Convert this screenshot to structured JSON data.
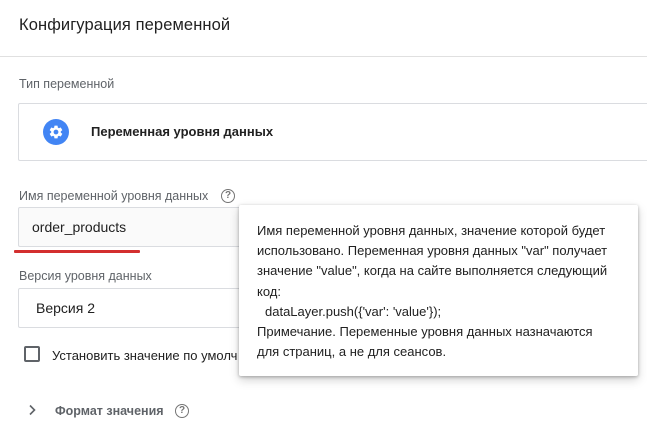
{
  "header": {
    "title": "Конфигурация переменной"
  },
  "variable_type": {
    "label": "Тип переменной",
    "name": "Переменная уровня данных",
    "icon": "gear-icon",
    "icon_color": "#4285f4"
  },
  "dlv_name": {
    "label": "Имя переменной уровня данных",
    "help_icon": "help-icon",
    "value": "order_products"
  },
  "dlv_version": {
    "label": "Версия уровня данных",
    "value": "Версия 2"
  },
  "default_value": {
    "label": "Установить значение по умолч",
    "checked": false
  },
  "format": {
    "label": "Формат значения",
    "icon": "chevron-right-icon"
  },
  "tooltip": {
    "lines": [
      "Имя переменной уровня данных, значение которой будет",
      "использовано. Переменная уровня данных \"var\" получает",
      "значение \"value\", когда на сайте выполняется следующий",
      "код:",
      "dataLayer.push({'var': 'value'});",
      "Примечание. Переменные уровня данных назначаются",
      "для страниц, а не для сеансов."
    ]
  },
  "colors": {
    "accent": "#4285f4",
    "error_underline": "#d32f2f"
  }
}
